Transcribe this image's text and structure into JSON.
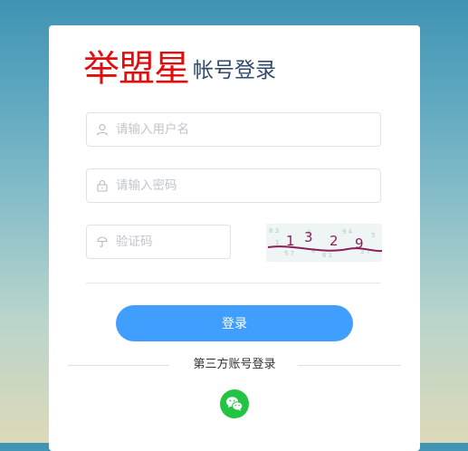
{
  "brand": {
    "name": "举盟星",
    "subtitle": "帐号登录",
    "color": "#e00e0e"
  },
  "form": {
    "username": {
      "placeholder": "请输入用户名",
      "icon": "user-icon"
    },
    "password": {
      "placeholder": "请输入密码",
      "icon": "lock-icon"
    },
    "captcha": {
      "placeholder": "验证码",
      "icon": "key-icon",
      "code": "1329"
    },
    "login_label": "登录"
  },
  "third_party": {
    "label": "第三方账号登录",
    "providers": [
      {
        "name": "wechat",
        "icon": "wechat-icon",
        "color": "#23c343"
      }
    ]
  },
  "colors": {
    "primary": "#409eff",
    "border": "#dfe3e8"
  }
}
